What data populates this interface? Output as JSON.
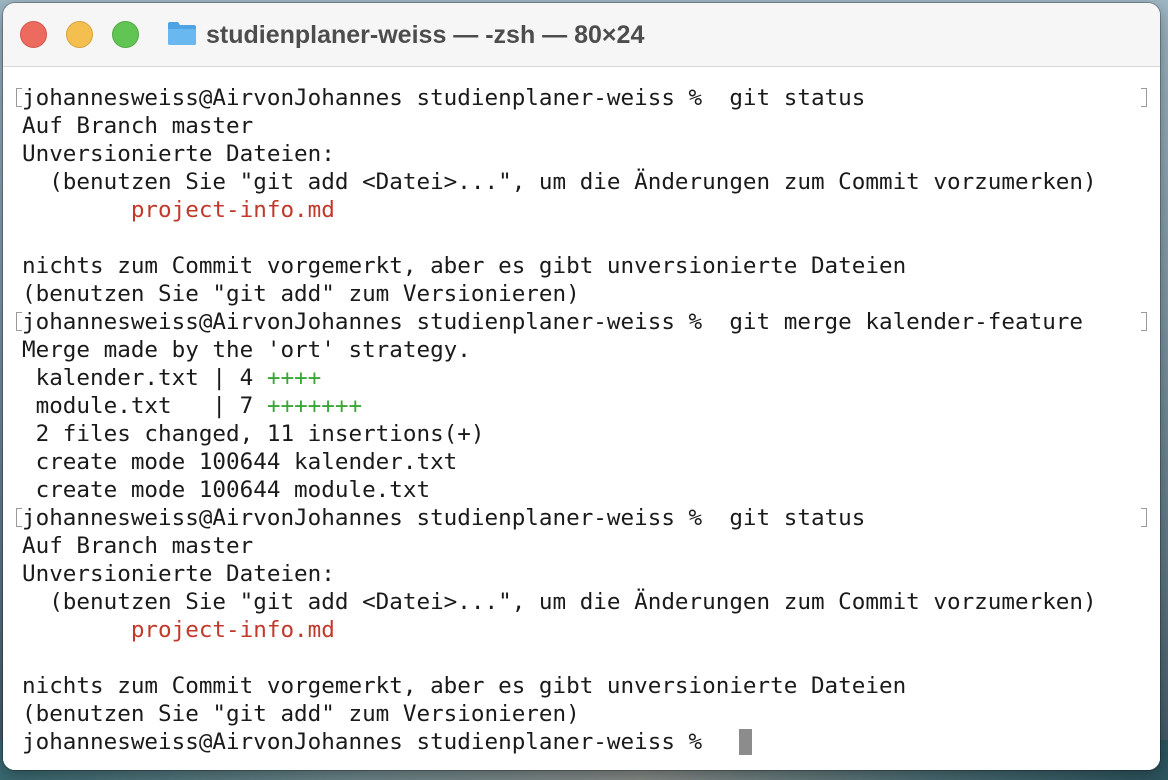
{
  "window": {
    "title": "studienplaner-weiss — -zsh — 80×24",
    "icon": "folder-icon"
  },
  "terminal": {
    "lines": [
      {
        "text": "johannesweiss@AirvonJohannes studienplaner-weiss %  git status",
        "suffix": "",
        "marked": true,
        "type": "prompt"
      },
      {
        "text": "Auf Branch master",
        "suffix": "",
        "type": "output"
      },
      {
        "text": "Unversionierte Dateien:",
        "suffix": "",
        "type": "output"
      },
      {
        "text": "  (benutzen Sie \"git add <Datei>...\", um die Änderungen zum Commit vorzumerken)",
        "suffix": "",
        "type": "output"
      },
      {
        "text": "        project-info.md",
        "suffix": "",
        "type": "untracked"
      },
      {
        "text": "",
        "suffix": "",
        "type": "blank"
      },
      {
        "text": "nichts zum Commit vorgemerkt, aber es gibt unversionierte Dateien",
        "suffix": "",
        "type": "output"
      },
      {
        "text": "(benutzen Sie \"git add\" zum Versionieren)",
        "suffix": "",
        "type": "output"
      },
      {
        "text": "johannesweiss@AirvonJohannes studienplaner-weiss %  git merge kalender-feature",
        "suffix": "",
        "marked": true,
        "type": "prompt"
      },
      {
        "text": "Merge made by the 'ort' strategy.",
        "suffix": "",
        "type": "output"
      },
      {
        "text": " kalender.txt | 4 ",
        "suffix": "++++",
        "type": "diffstat"
      },
      {
        "text": " module.txt   | 7 ",
        "suffix": "+++++++",
        "type": "diffstat"
      },
      {
        "text": " 2 files changed, 11 insertions(+)",
        "suffix": "",
        "type": "output"
      },
      {
        "text": " create mode 100644 kalender.txt",
        "suffix": "",
        "type": "output"
      },
      {
        "text": " create mode 100644 module.txt",
        "suffix": "",
        "type": "output"
      },
      {
        "text": "johannesweiss@AirvonJohannes studienplaner-weiss %  git status",
        "suffix": "",
        "marked": true,
        "type": "prompt"
      },
      {
        "text": "Auf Branch master",
        "suffix": "",
        "type": "output"
      },
      {
        "text": "Unversionierte Dateien:",
        "suffix": "",
        "type": "output"
      },
      {
        "text": "  (benutzen Sie \"git add <Datei>...\", um die Änderungen zum Commit vorzumerken)",
        "suffix": "",
        "type": "output"
      },
      {
        "text": "        project-info.md",
        "suffix": "",
        "type": "untracked"
      },
      {
        "text": "",
        "suffix": "",
        "type": "blank"
      },
      {
        "text": "nichts zum Commit vorgemerkt, aber es gibt unversionierte Dateien",
        "suffix": "",
        "type": "output"
      },
      {
        "text": "(benutzen Sie \"git add\" zum Versionieren)",
        "suffix": "",
        "type": "output"
      },
      {
        "text": "johannesweiss@AirvonJohannes studienplaner-weiss % ",
        "suffix": "",
        "type": "current-prompt"
      }
    ]
  },
  "colors": {
    "untracked": "#c0392b",
    "insertions": "#3aa635",
    "cursor": "#8c8c8c"
  }
}
